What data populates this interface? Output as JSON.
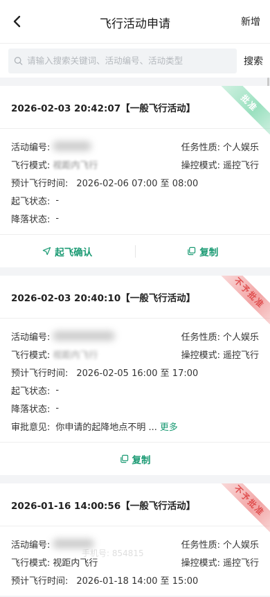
{
  "header": {
    "title": "飞行活动申请",
    "add_label": "新增"
  },
  "search": {
    "placeholder": "请输入搜索关键词、活动编号、活动类型",
    "button_label": "搜索"
  },
  "labels": {
    "activity_no": "活动编号:",
    "task_nature": "任务性质:",
    "flight_mode": "飞行模式:",
    "control_mode": "操控模式:",
    "planned_time": "预计飞行时间:",
    "takeoff_status": "起飞状态:",
    "landing_status": "降落状态:",
    "approval_opinion": "审批意见:"
  },
  "cards": [
    {
      "header": "2026-02-03 20:42:07【一般飞行活动】",
      "status": "批准",
      "task_nature": "个人娱乐",
      "flight_mode": "视距内飞行",
      "control_mode": "遥控飞行",
      "planned_time": "2026-02-06 07:00 至 08:00",
      "takeoff_status": "-",
      "landing_status": "-",
      "action_primary": "起飞确认",
      "action_copy": "复制"
    },
    {
      "header": "2026-02-03 20:40:10【一般飞行活动】",
      "status": "不予批准",
      "task_nature": "个人娱乐",
      "flight_mode": "视距内飞行",
      "control_mode": "遥控飞行",
      "planned_time": "2026-02-05 16:00 至 17:00",
      "takeoff_status": "-",
      "landing_status": "-",
      "approval_opinion": "你申请的起降地点不明 ...",
      "more_label": "更多",
      "action_copy": "复制"
    },
    {
      "header": "2026-01-16 14:00:56【一般飞行活动】",
      "status": "不予批准",
      "task_nature": "个人娱乐",
      "flight_mode": "视距内飞行",
      "control_mode": "遥控飞行",
      "planned_time": "2026-01-18 14:00 至 15:00"
    }
  ],
  "watermark": "手机号: 854815"
}
